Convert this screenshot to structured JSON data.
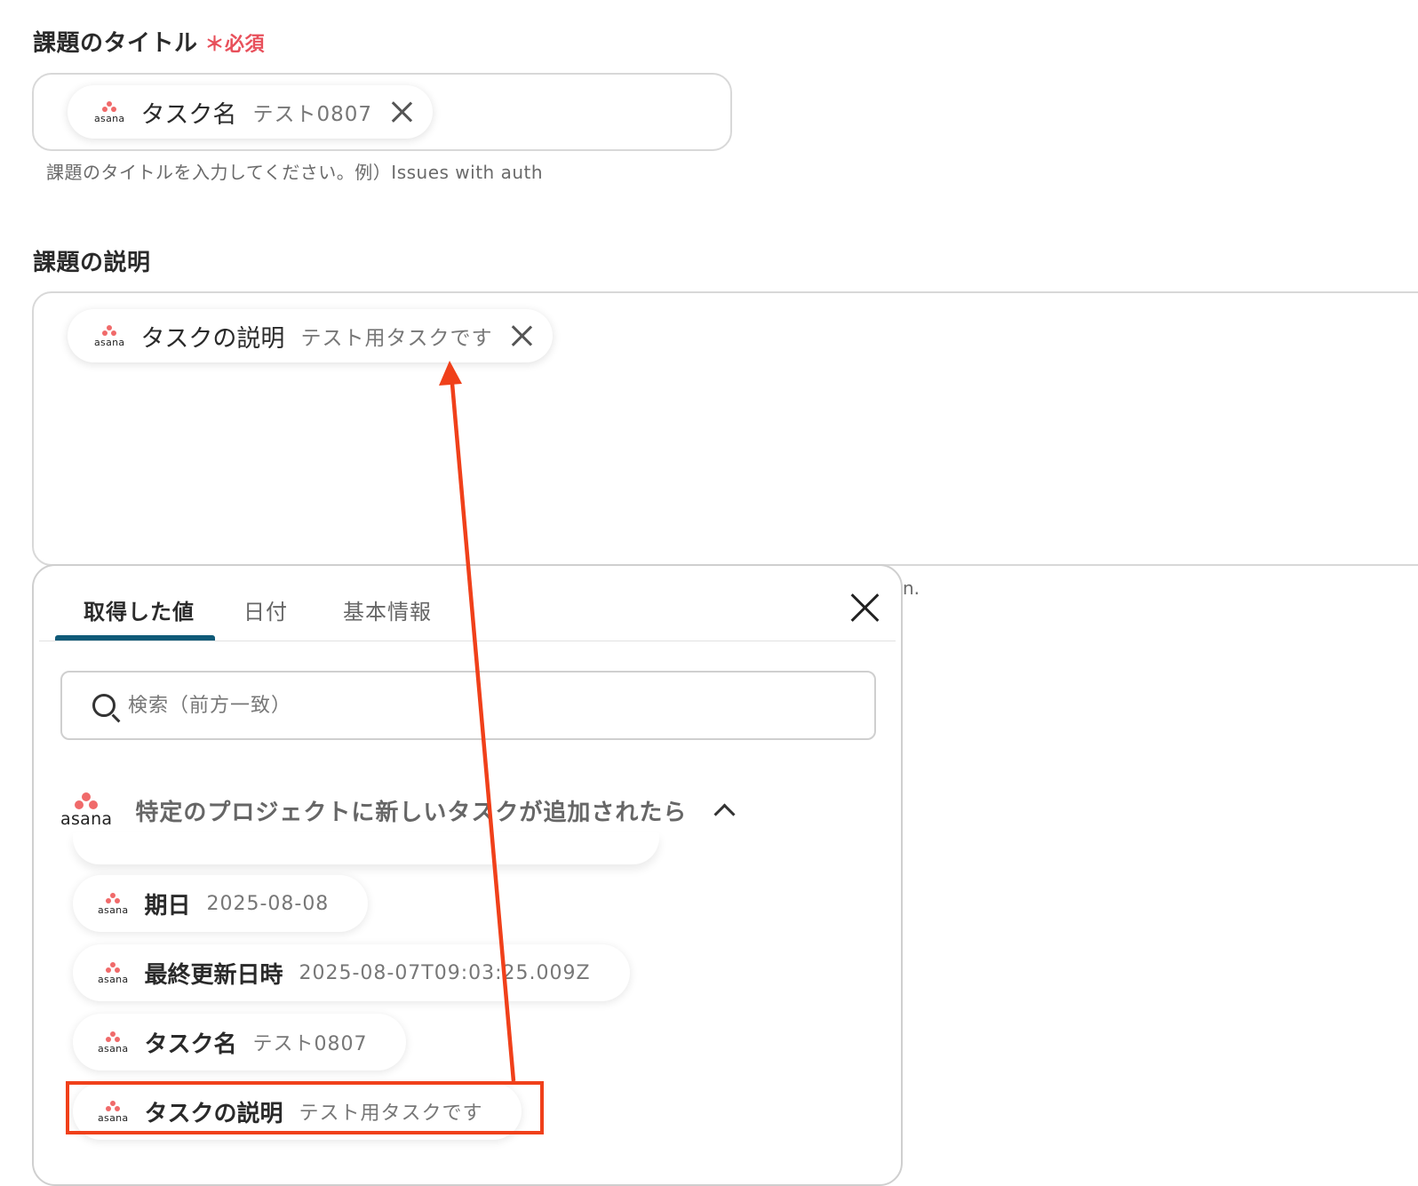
{
  "title_field": {
    "label": "課題のタイトル",
    "required_mark": "＊",
    "required_text": "必須",
    "chip": {
      "key": "タスク名",
      "value": "テスト0807",
      "app": "asana"
    },
    "hint": "課題のタイトルを入力してください。例）Issues with auth"
  },
  "description_field": {
    "label": "課題の説明",
    "chip": {
      "key": "タスクの説明",
      "value": "テスト用タスクです",
      "app": "asana"
    },
    "hint_tail": "n."
  },
  "picker": {
    "tabs": [
      {
        "label": "取得した値",
        "active": true
      },
      {
        "label": "日付",
        "active": false
      },
      {
        "label": "基本情報",
        "active": false
      }
    ],
    "search_placeholder": "検索（前方一致）",
    "group": {
      "app": "asana",
      "title": "特定のプロジェクトに新しいタスクが追加されたら"
    },
    "items": [
      {
        "key": "期日",
        "value": "2025-08-08",
        "app": "asana"
      },
      {
        "key": "最終更新日時",
        "value": "2025-08-07T09:03:25.009Z",
        "app": "asana"
      },
      {
        "key": "タスク名",
        "value": "テスト0807",
        "app": "asana"
      },
      {
        "key": "タスクの説明",
        "value": "テスト用タスクです",
        "app": "asana",
        "highlighted": true
      }
    ]
  },
  "annotation": {
    "color": "#f0401a"
  }
}
